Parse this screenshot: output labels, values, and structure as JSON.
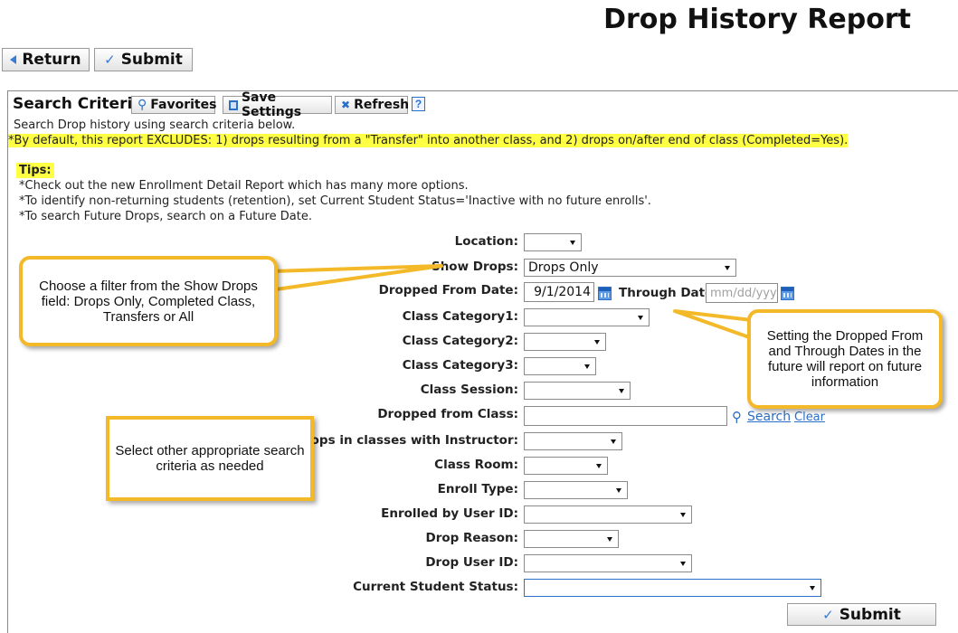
{
  "page_title": "Drop History Report",
  "top_buttons": {
    "return_label": "Return",
    "submit_label": "Submit"
  },
  "panel": {
    "title": "Search Criteria",
    "favorites_label": "Favorites",
    "save_settings_label": "Save Settings",
    "refresh_label": "Refresh",
    "help_label": "?",
    "intro": "Search Drop history using search criteria below.",
    "default_note": "*By default, this report EXCLUDES: 1) drops resulting from a \"Transfer\" into another class, and 2) drops on/after end of class (Completed=Yes).",
    "tips_heading": "Tips:",
    "tips": [
      "*Check out the new Enrollment Detail Report which has many more options.",
      "*To identify non-returning students (retention), set Current Student Status='Inactive with no future enrolls'.",
      "*To search Future Drops, search on a Future Date."
    ]
  },
  "form": {
    "location": {
      "label": "Location:",
      "value": ""
    },
    "show_drops": {
      "label": "Show Drops:",
      "value": "Drops Only"
    },
    "dropped_from_date": {
      "label": "Dropped From Date:",
      "value": "9/1/2014"
    },
    "through_date": {
      "label": "Through Date:",
      "placeholder": "mm/dd/yyy"
    },
    "class_category1": {
      "label": "Class Category1:",
      "value": ""
    },
    "class_category2": {
      "label": "Class Category2:",
      "value": ""
    },
    "class_category3": {
      "label": "Class Category3:",
      "value": ""
    },
    "class_session": {
      "label": "Class Session:",
      "value": ""
    },
    "dropped_from_class": {
      "label": "Dropped from Class:",
      "value": "",
      "search_link": "Search",
      "clear_link": "Clear"
    },
    "instructor": {
      "label": "Drops in classes with Instructor:",
      "value": ""
    },
    "class_room": {
      "label": "Class Room:",
      "value": ""
    },
    "enroll_type": {
      "label": "Enroll Type:",
      "value": ""
    },
    "enrolled_by_user": {
      "label": "Enrolled by User ID:",
      "value": ""
    },
    "drop_reason": {
      "label": "Drop Reason:",
      "value": ""
    },
    "drop_user": {
      "label": "Drop User ID:",
      "value": ""
    },
    "current_student_status": {
      "label": "Current Student Status:",
      "value": ""
    },
    "submit_label": "Submit"
  },
  "callouts": {
    "show_drops": "Choose a filter from the Show Drops field: Drops Only, Completed Class, Transfers or All",
    "dates": "Setting the Dropped From and Through Dates in the future will report on future information",
    "other": "Select other appropriate search criteria as needed"
  },
  "colors": {
    "callout_border": "#f4b928",
    "highlight": "#ffff44",
    "link": "#2a6fc9"
  }
}
